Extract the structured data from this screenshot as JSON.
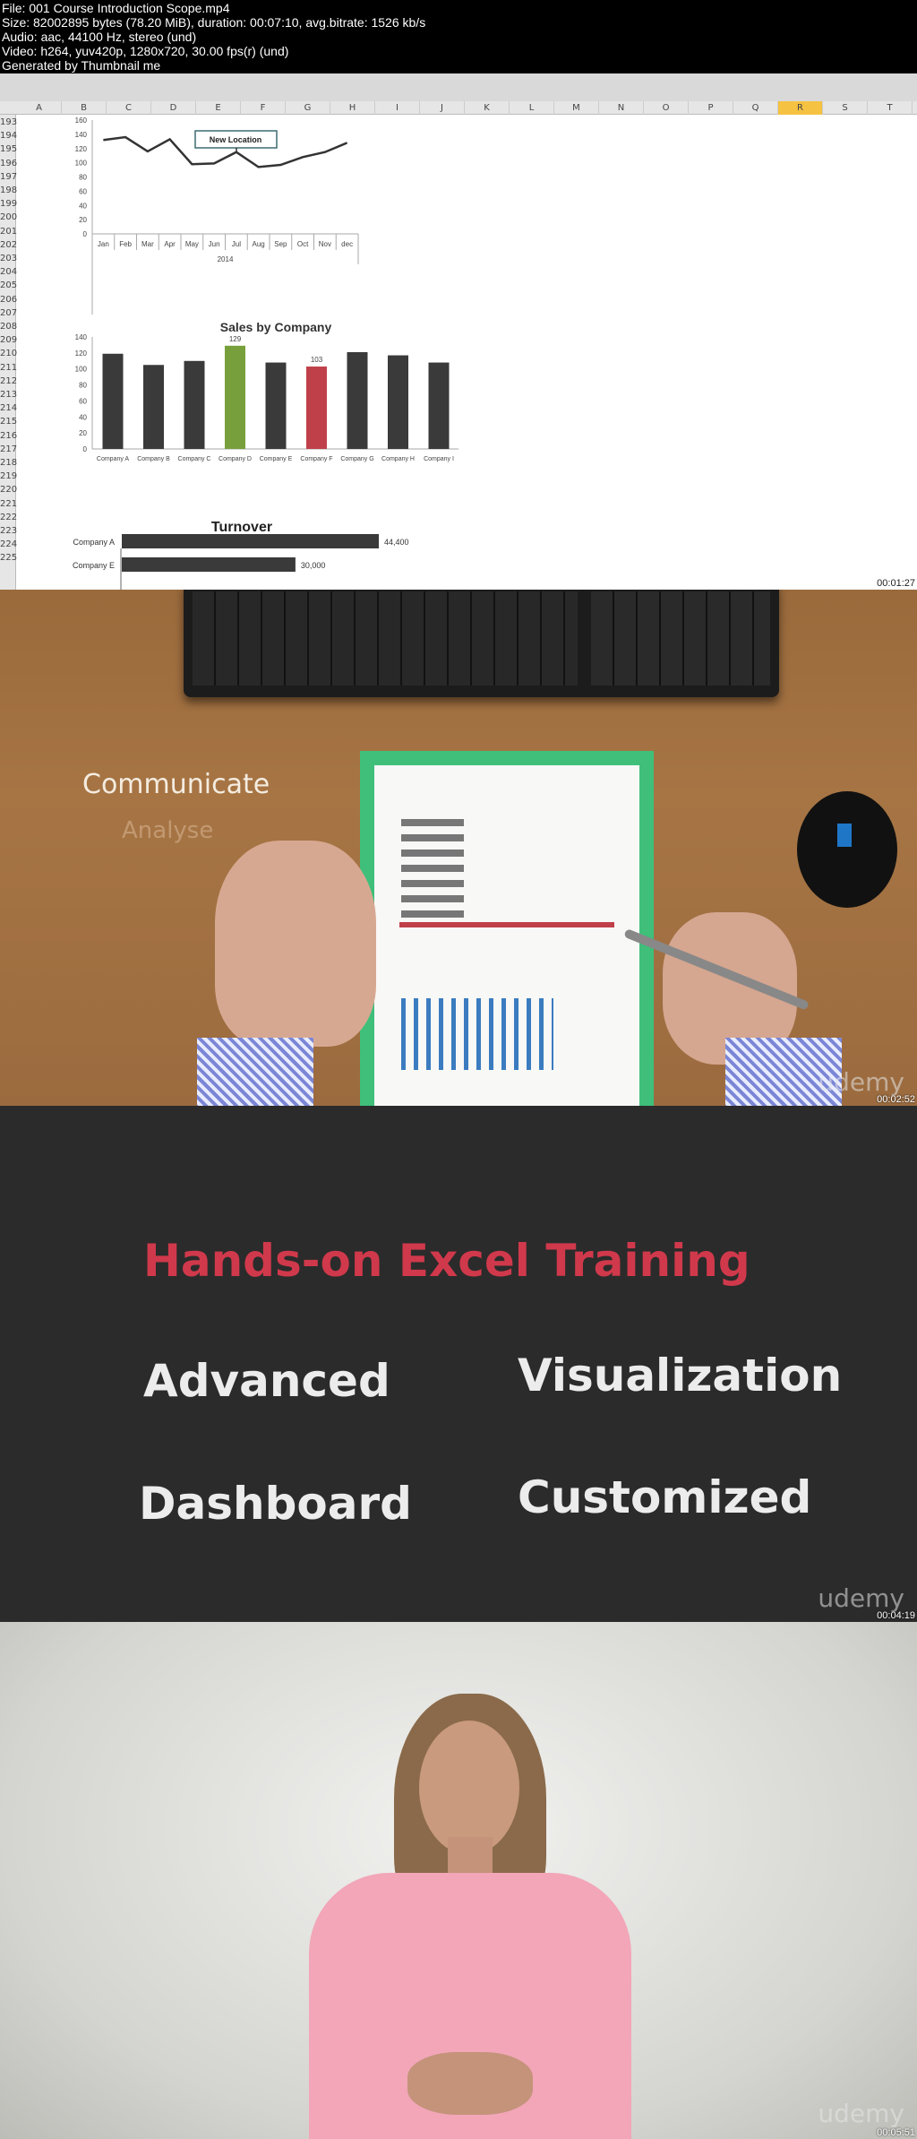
{
  "header": {
    "lines": [
      "File: 001 Course Introduction  Scope.mp4",
      "Size: 82002895 bytes (78.20 MiB), duration: 00:07:10, avg.bitrate: 1526 kb/s",
      "Audio: aac, 44100 Hz, stereo (und)",
      "Video: h264, yuv420p, 1280x720, 30.00 fps(r) (und)",
      "Generated by Thumbnail me"
    ]
  },
  "frames": [
    {
      "timestamp": "00:01:27"
    },
    {
      "timestamp": "00:02:52",
      "watermark": "udemy",
      "overlay_text": "Communicate",
      "overlay_faded": "Analyse"
    },
    {
      "timestamp": "00:04:19",
      "watermark": "udemy",
      "title": "Hands-on Excel Training",
      "keywords": [
        "Advanced",
        "Visualization",
        "Dashboard",
        "Customized"
      ],
      "title_color": "#d0394b"
    },
    {
      "timestamp": "00:05:51",
      "watermark": "udemy"
    }
  ],
  "spreadsheet": {
    "columns": [
      "A",
      "B",
      "C",
      "D",
      "E",
      "F",
      "G",
      "H",
      "I",
      "J",
      "K",
      "L",
      "M",
      "N",
      "O",
      "P",
      "Q",
      "R",
      "S",
      "T"
    ],
    "selected_column": "R",
    "rows": [
      "193",
      "194",
      "195",
      "196",
      "197",
      "198",
      "199",
      "200",
      "201",
      "202",
      "203",
      "204",
      "205",
      "206",
      "207",
      "208",
      "209",
      "210",
      "211",
      "212",
      "213",
      "214",
      "215",
      "216",
      "217",
      "218",
      "219",
      "220",
      "221",
      "222",
      "223",
      "224",
      "225"
    ]
  },
  "chart_data": [
    {
      "type": "line",
      "title": "",
      "categories": [
        "Jan",
        "Feb",
        "Mar",
        "Apr",
        "May",
        "Jun",
        "Jul",
        "Aug",
        "Sep",
        "Oct",
        "Nov",
        "dec"
      ],
      "values": [
        132,
        136,
        116,
        133,
        98,
        99,
        115,
        94,
        97,
        108,
        115,
        128
      ],
      "xlabel": "2014",
      "ylim": [
        0,
        160
      ],
      "yticks": [
        "0",
        "20",
        "40",
        "60",
        "80",
        "100",
        "120",
        "140",
        "160"
      ],
      "annotation": "New Location",
      "color": "#333333"
    },
    {
      "type": "bar",
      "title": "Sales by Company",
      "categories": [
        "Company A",
        "Company B",
        "Company C",
        "Company D",
        "Company E",
        "Company F",
        "Company G",
        "Company H",
        "Company I"
      ],
      "values": [
        119,
        105,
        110,
        129,
        108,
        103,
        121,
        117,
        108
      ],
      "data_labels": {
        "3": "129",
        "5": "103"
      },
      "colors": {
        "default": "#3a3a3a",
        "highlight_high": "#77a03c",
        "highlight_low": "#c0404a"
      },
      "ylim": [
        0,
        140
      ],
      "yticks": [
        "0",
        "20",
        "40",
        "60",
        "80",
        "100",
        "120",
        "140"
      ]
    },
    {
      "type": "bar",
      "orientation": "horizontal",
      "title": "Turnover",
      "categories": [
        "Company A",
        "Company E"
      ],
      "values": [
        44400,
        30000
      ],
      "data_labels": [
        "44,400",
        "30,000"
      ]
    }
  ]
}
